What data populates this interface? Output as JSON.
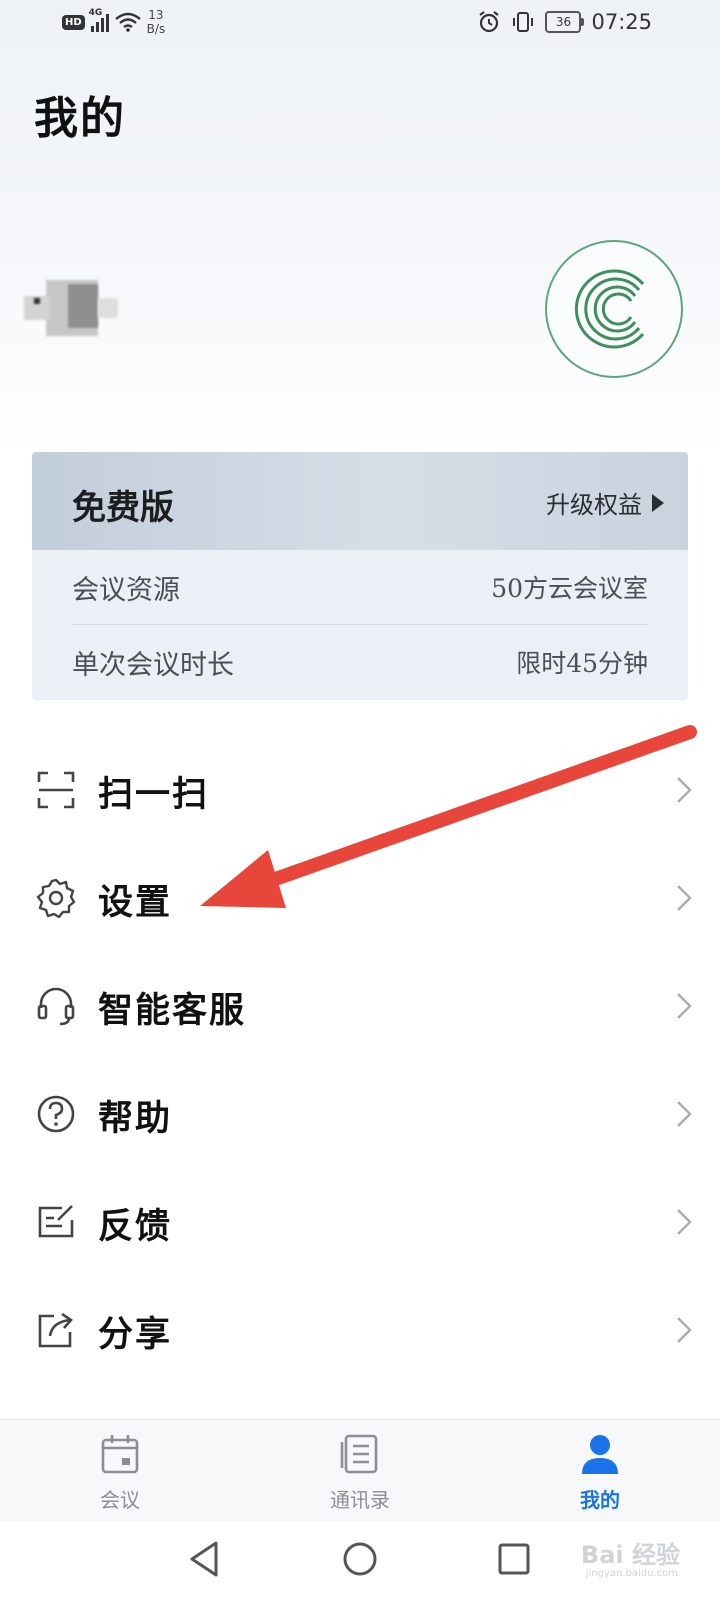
{
  "status_bar": {
    "network_badge": "HD",
    "network_type": "4G",
    "speed_value": "13",
    "speed_unit": "B/s",
    "battery": "36",
    "time": "07:25"
  },
  "header": {
    "title": "我的"
  },
  "plan": {
    "name": "免费版",
    "upgrade_label": "升级权益",
    "rows": [
      {
        "label": "会议资源",
        "value": "50方云会议室"
      },
      {
        "label": "单次会议时长",
        "value": "限时45分钟"
      }
    ]
  },
  "menu": {
    "items": [
      {
        "label": "扫一扫",
        "icon": "scan-icon"
      },
      {
        "label": "设置",
        "icon": "gear-icon"
      },
      {
        "label": "智能客服",
        "icon": "headset-icon"
      },
      {
        "label": "帮助",
        "icon": "help-icon"
      },
      {
        "label": "反馈",
        "icon": "feedback-icon"
      },
      {
        "label": "分享",
        "icon": "share-icon"
      }
    ]
  },
  "bottom_nav": {
    "items": [
      {
        "label": "会议",
        "icon": "calendar-icon"
      },
      {
        "label": "通讯录",
        "icon": "contacts-icon"
      },
      {
        "label": "我的",
        "icon": "person-icon",
        "active": true
      }
    ]
  },
  "colors": {
    "accent": "#1a73e8",
    "logo_green": "#5fa57b",
    "annotation_red": "#e8463a"
  },
  "watermark": {
    "text": "Bai 经验",
    "sub": "jingyan.baidu.com"
  }
}
